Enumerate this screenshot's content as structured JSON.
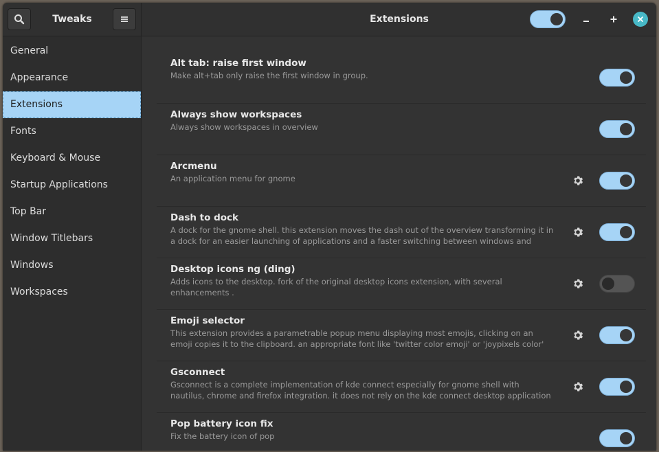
{
  "header": {
    "app_title": "Tweaks",
    "window_title": "Extensions",
    "master_toggle_on": true,
    "icons": {
      "search": "search-icon",
      "menu": "hamburger-menu-icon",
      "minimize": "minimize-icon",
      "maximize": "maximize-icon",
      "close": "close-icon"
    }
  },
  "colors": {
    "accent": "#a6d4f6",
    "close": "#48b9c7",
    "background": "#333333",
    "sidebar": "#2d2d2d"
  },
  "sidebar": {
    "selected": "Extensions",
    "items": [
      {
        "label": "General"
      },
      {
        "label": "Appearance"
      },
      {
        "label": "Extensions"
      },
      {
        "label": "Fonts"
      },
      {
        "label": "Keyboard & Mouse"
      },
      {
        "label": "Startup Applications"
      },
      {
        "label": "Top Bar"
      },
      {
        "label": "Window Titlebars"
      },
      {
        "label": "Windows"
      },
      {
        "label": "Workspaces"
      }
    ]
  },
  "extensions": [
    {
      "title": "Alt tab: raise first window",
      "description": "Make alt+tab only raise the first window in group.",
      "settings": false,
      "enabled": true
    },
    {
      "title": "Always show workspaces",
      "description": "Always show workspaces in overview",
      "settings": false,
      "enabled": true
    },
    {
      "title": "Arcmenu",
      "description": "An application menu for gnome",
      "settings": true,
      "enabled": true
    },
    {
      "title": "Dash to dock",
      "description": "A dock for the gnome shell. this extension moves the dash out of the overview transforming it in a dock for an easier launching of applications and a faster switching between windows and desktop...",
      "settings": true,
      "enabled": true
    },
    {
      "title": "Desktop icons ng (ding)",
      "description": "Adds icons to the desktop. fork of the original desktop icons extension, with several enhancements .",
      "settings": true,
      "enabled": false
    },
    {
      "title": "Emoji selector",
      "description": "This extension provides a parametrable popup menu displaying most emojis, clicking on an emoji copies it to the clipboard. an appropriate font like 'twitter color emoji' or 'joypixels color' should b...",
      "settings": true,
      "enabled": true
    },
    {
      "title": "Gsconnect",
      "description": "Gsconnect is a complete implementation of kde connect especially for gnome shell with nautilus, chrome and firefox integration. it does not rely on the kde connect desktop application and will not ...",
      "settings": true,
      "enabled": true
    },
    {
      "title": "Pop battery icon fix",
      "description": "Fix the battery icon of pop",
      "settings": false,
      "enabled": true
    }
  ]
}
